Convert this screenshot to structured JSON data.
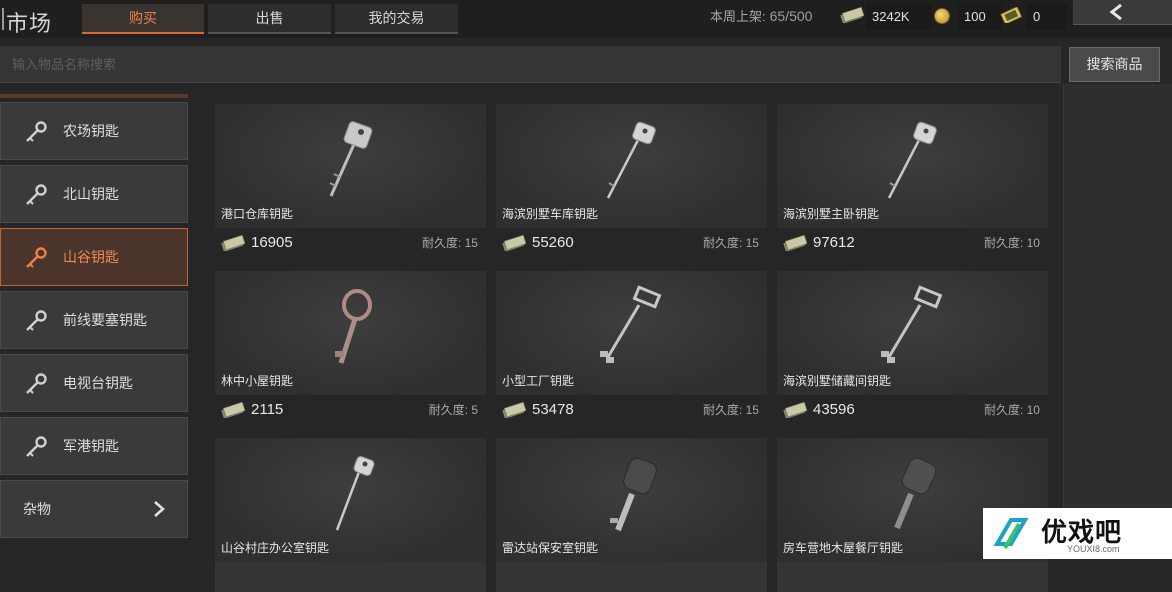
{
  "header": {
    "title": "市场",
    "tabs": {
      "buy": "购买",
      "sell": "出售",
      "my_trades": "我的交易"
    },
    "weekly_listed_label": "本周上架:",
    "weekly_listed_value": "65/500",
    "currencies": {
      "cash": "3242K",
      "coins": "100",
      "bills": "0"
    }
  },
  "search": {
    "placeholder": "输入物品名称搜索",
    "button_label": "搜索商品"
  },
  "sidebar": {
    "items": [
      {
        "label": "农场钥匙"
      },
      {
        "label": "北山钥匙"
      },
      {
        "label": "山谷钥匙",
        "active": true
      },
      {
        "label": "前线要塞钥匙"
      },
      {
        "label": "电视台钥匙"
      },
      {
        "label": "军港钥匙"
      },
      {
        "label": "杂物"
      }
    ]
  },
  "listings": [
    {
      "name": "港口仓库钥匙",
      "price": "16905",
      "durability": "耐久度: 15",
      "icon": "key-silver-head"
    },
    {
      "name": "海滨别墅车库钥匙",
      "price": "55260",
      "durability": "耐久度: 15",
      "icon": "key-silver-head"
    },
    {
      "name": "海滨别墅主卧钥匙",
      "price": "97612",
      "durability": "耐久度: 10",
      "icon": "key-silver-head"
    },
    {
      "name": "林中小屋钥匙",
      "price": "2115",
      "durability": "耐久度: 5",
      "icon": "key-skeleton-ring"
    },
    {
      "name": "小型工厂钥匙",
      "price": "53478",
      "durability": "耐久度: 15",
      "icon": "key-square-head"
    },
    {
      "name": "海滨别墅储藏间钥匙",
      "price": "43596",
      "durability": "耐久度: 10",
      "icon": "key-square-head"
    },
    {
      "name": "山谷村庄办公室钥匙",
      "price": "",
      "durability": "",
      "icon": "key-silver-head"
    },
    {
      "name": "雷达站保安室钥匙",
      "price": "",
      "durability": "",
      "icon": "key-dark-head"
    },
    {
      "name": "房车营地木屋餐厅钥匙",
      "price": "",
      "durability": "",
      "icon": "key-dark-head"
    }
  ],
  "watermark": {
    "text": "优戏吧",
    "url": "YOUXI8.com"
  },
  "colors": {
    "accent": "#e9824a",
    "background": "#262626",
    "card": "#343434"
  }
}
